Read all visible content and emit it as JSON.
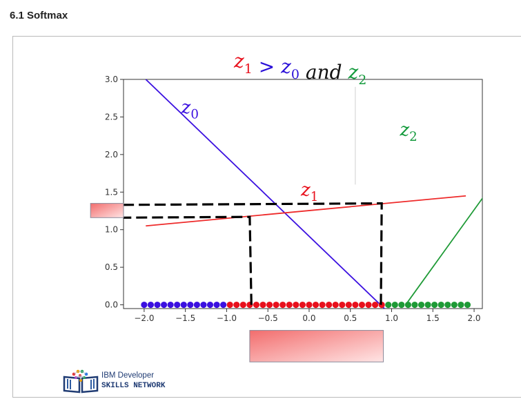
{
  "header": {
    "section_title": "6.1 Softmax"
  },
  "chart_data": {
    "type": "line",
    "title_parts": [
      {
        "text": "z",
        "sub": "1",
        "color": "#e8101c"
      },
      {
        "text": " > ",
        "sub": "",
        "color": "#2a10d8"
      },
      {
        "text": "z",
        "sub": "0",
        "color": "#2a10d8"
      },
      {
        "text": " and ",
        "sub": "",
        "color": "#111111"
      },
      {
        "text": "z",
        "sub": "2",
        "color": "#139a3c"
      }
    ],
    "xlim": [
      -2.25,
      2.1
    ],
    "ylim": [
      -0.05,
      3.0
    ],
    "xticks": [
      -2.0,
      -1.5,
      -1.0,
      -0.5,
      0.0,
      0.5,
      1.0,
      1.5,
      2.0
    ],
    "xtick_labels": [
      "−2.0",
      "−1.5",
      "−1.0",
      "−0.5",
      "0.0",
      "0.5",
      "1.0",
      "1.5",
      "2.0"
    ],
    "yticks": [
      0.0,
      0.5,
      1.0,
      1.5,
      2.0,
      2.5,
      3.0
    ],
    "ytick_labels": [
      "0.0",
      "0.5",
      "1.0",
      "1.5",
      "2.0",
      "2.5",
      "3.0"
    ],
    "series": [
      {
        "name": "z",
        "sub": "0",
        "color": "#3b10e0",
        "x": [
          -1.98,
          0.96
        ],
        "y": [
          3.0,
          -0.1
        ]
      },
      {
        "name": "z",
        "sub": "1",
        "color": "#ee2a2a",
        "x": [
          -1.98,
          1.9
        ],
        "y": [
          1.05,
          1.45
        ]
      },
      {
        "name": "z",
        "sub": "2",
        "color": "#1e9a36",
        "x": [
          1.17,
          3.14
        ],
        "y": [
          0.0,
          3.0
        ]
      }
    ],
    "series_labels": [
      {
        "name": "z",
        "sub": "0",
        "color": "#3b10e0",
        "x": -1.55,
        "y": 2.55
      },
      {
        "name": "z",
        "sub": "1",
        "color": "#e8101c",
        "x": -0.1,
        "y": 1.45
      },
      {
        "name": "z",
        "sub": "2",
        "color": "#139a3c",
        "x": 1.1,
        "y": 2.25
      }
    ],
    "points": [
      {
        "color": "#3b10e0",
        "x": [
          -2.0,
          -1.92,
          -1.84,
          -1.76,
          -1.68,
          -1.6,
          -1.52,
          -1.44,
          -1.36,
          -1.28,
          -1.2,
          -1.12,
          -1.04
        ]
      },
      {
        "color": "#e8101c",
        "x": [
          -0.96,
          -0.88,
          -0.8,
          -0.72,
          -0.64,
          -0.56,
          -0.48,
          -0.4,
          -0.32,
          -0.24,
          -0.16,
          -0.08,
          0.0,
          0.08,
          0.16,
          0.24,
          0.32,
          0.4,
          0.48,
          0.56,
          0.64,
          0.72,
          0.8,
          0.88
        ]
      },
      {
        "color": "#1e9a36",
        "x": [
          0.96,
          1.04,
          1.12,
          1.2,
          1.28,
          1.36,
          1.44,
          1.52,
          1.6,
          1.68,
          1.76,
          1.84,
          1.92
        ]
      }
    ],
    "dashed_paths": [
      {
        "x": [
          -0.7,
          -0.72,
          -2.25
        ],
        "y": [
          0.0,
          1.17,
          1.16
        ]
      },
      {
        "x": [
          0.87,
          0.88,
          -2.25
        ],
        "y": [
          0.0,
          1.35,
          1.33
        ]
      }
    ],
    "grey_line": {
      "x": [
        0.56,
        0.56
      ],
      "y": [
        1.6,
        2.9
      ]
    },
    "cover_boxes": [
      {
        "x0": -2.65,
        "x1": -2.25,
        "y0": 1.16,
        "y1": 1.35
      },
      {
        "x0": -0.72,
        "x1": 0.9,
        "y0": -0.34,
        "y1": -0.76
      }
    ],
    "grid": false
  },
  "logo": {
    "line1": "IBM Developer",
    "line2": "SKILLS NETWORK",
    "icon": "book-network-icon"
  }
}
